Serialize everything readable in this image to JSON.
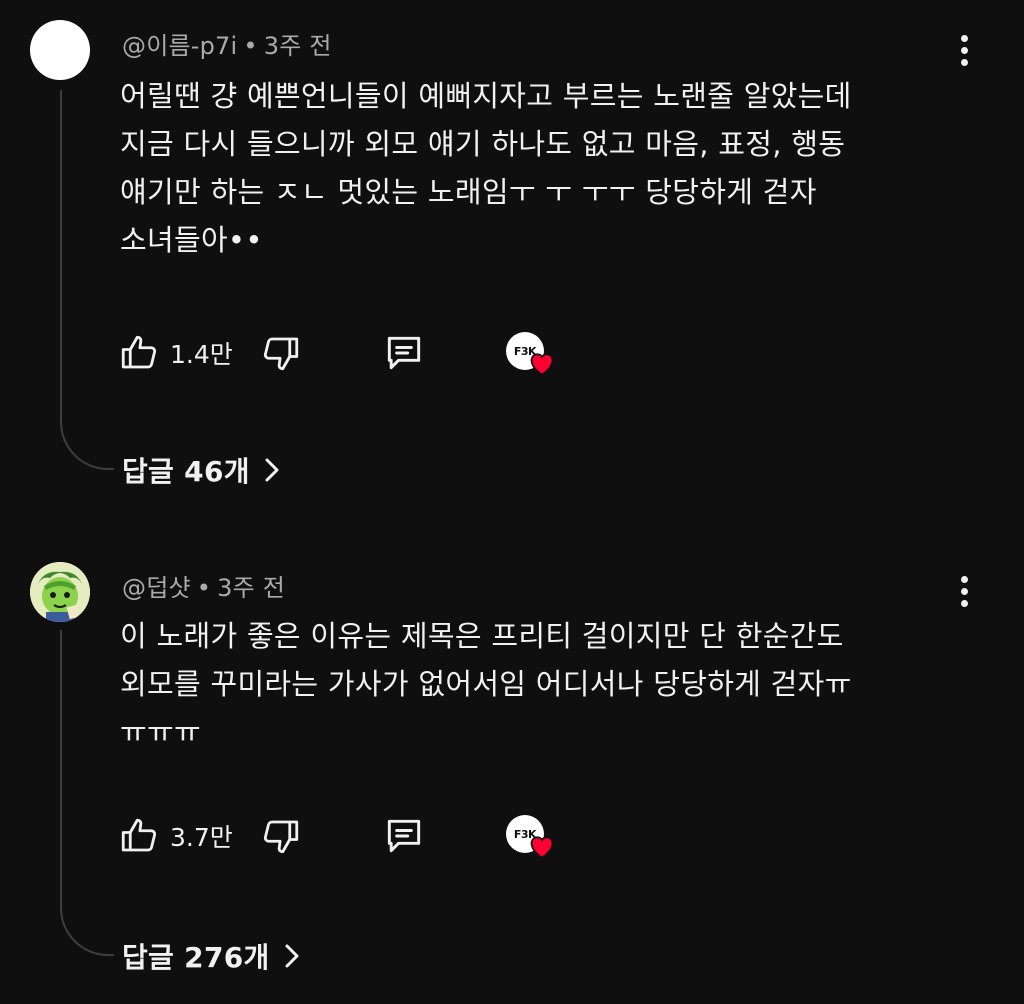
{
  "comments": [
    {
      "author": "@이름-p7i",
      "time": "3주 전",
      "text": "어릴땐 걍 예쁜언니들이 예뻐지자고 부르는 노랜줄 알았는데\n지금 다시 들으니까 외모 얘기 하나도 없고 마음, 표정, 행동\n얘기만 하는 ㅈㄴ 멋있는 노래임ㅜ ㅜ ㅜㅜ 당당하게 걷자\n소녀들아••",
      "likes": "1.4만",
      "replies": "답글 46개",
      "avatar": "white-circle",
      "creator_badge": "F3K"
    },
    {
      "author": "@덥샷",
      "time": "3주 전",
      "text": "이 노래가 좋은 이유는 제목은 프리티 걸이지만 단 한순간도\n외모를 꾸미라는 가사가 없어서임 어디서나 당당하게 걷자ㅠ\nㅠㅠㅠ",
      "likes": "3.7만",
      "replies": "답글 276개",
      "avatar": "green-character",
      "creator_badge": "F3K"
    }
  ],
  "icons": {
    "like": "thumbs-up-icon",
    "dislike": "thumbs-down-icon",
    "reply": "comment-icon",
    "more": "more-vertical-icon",
    "heart": "heart-icon",
    "chevron": "chevron-right-icon"
  },
  "colors": {
    "background": "#0f0f0f",
    "text": "#f1f1f1",
    "meta": "#aaaaaa",
    "heart": "#ff0033"
  }
}
